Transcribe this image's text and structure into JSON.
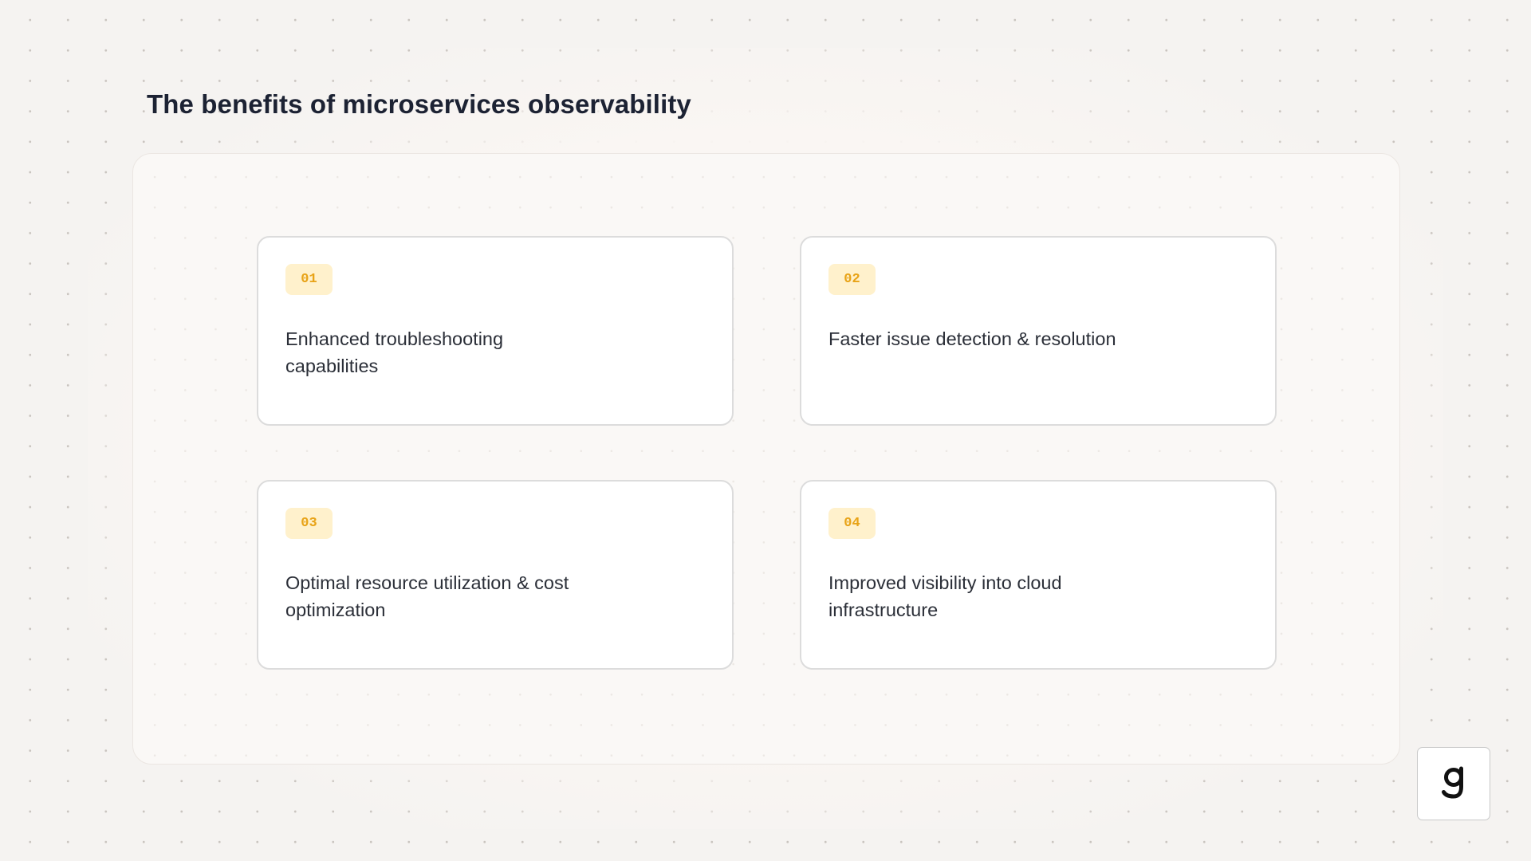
{
  "page": {
    "title": "The benefits of microservices observability"
  },
  "cards": [
    {
      "number": "01",
      "text": "Enhanced troubleshooting capabilities"
    },
    {
      "number": "02",
      "text": "Faster issue detection & resolution"
    },
    {
      "number": "03",
      "text": "Optimal resource utilization & cost optimization"
    },
    {
      "number": "04",
      "text": "Improved visibility into cloud infrastructure"
    }
  ],
  "logo": {
    "letter": "g",
    "icon": "brand-g-logo"
  },
  "colors": {
    "background": "#f5f3f1",
    "title": "#1c2233",
    "badge_background": "#fff1cc",
    "badge_text": "#e8a317",
    "card_border": "#dcdcdc",
    "card_text": "#2b2f38"
  }
}
